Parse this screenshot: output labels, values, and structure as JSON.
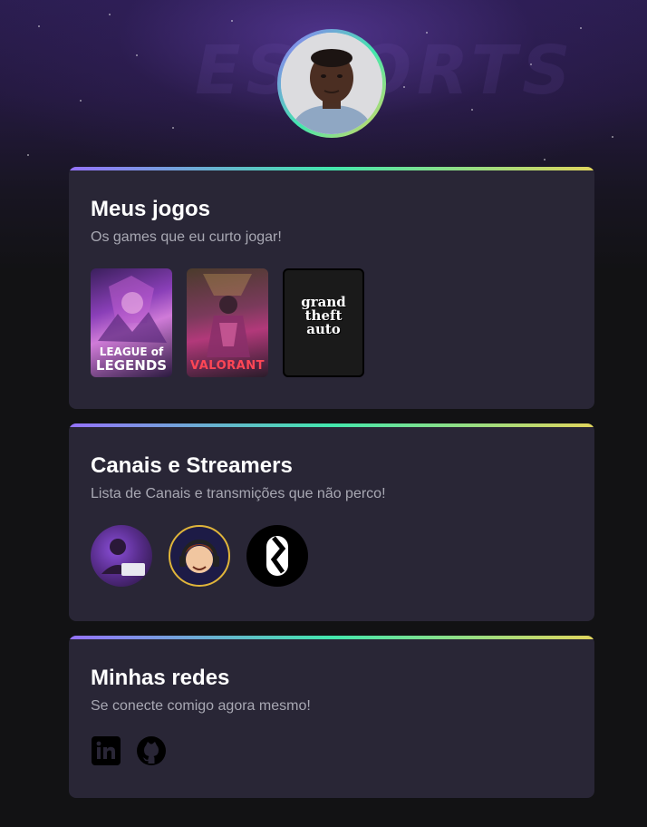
{
  "header": {
    "avatar_alt": "Profile photo"
  },
  "sections": {
    "games": {
      "title": "Meus jogos",
      "subtitle": "Os games que eu curto jogar!",
      "items": [
        {
          "name": "League of Legends",
          "label_line1": "LEAGUE of",
          "label_line2": "LEGENDS",
          "icon": "league-of-legends-cover"
        },
        {
          "name": "Valorant",
          "label_line1": "VALORANT",
          "icon": "valorant-cover"
        },
        {
          "name": "Grand Theft Auto V",
          "label_line1": "grand",
          "label_line2": "theft",
          "label_line3": "auto",
          "icon": "gta-v-cover"
        }
      ]
    },
    "streamers": {
      "title": "Canais e Streamers",
      "subtitle": "Lista de Canais e transmições que não perco!",
      "items": [
        {
          "icon": "streamer-avatar-1"
        },
        {
          "icon": "streamer-avatar-2"
        },
        {
          "icon": "streamer-avatar-3"
        }
      ]
    },
    "socials": {
      "title": "Minhas redes",
      "subtitle": "Se conecte comigo agora mesmo!",
      "items": [
        {
          "name": "LinkedIn",
          "icon": "linkedin-icon"
        },
        {
          "name": "GitHub",
          "icon": "github-icon"
        }
      ]
    }
  },
  "colors": {
    "background": "#121214",
    "card": "#292636",
    "gradient_start": "#9572fc",
    "gradient_mid": "#43e7ad",
    "gradient_end": "#e1d55d",
    "subtitle": "#a8a8b3"
  }
}
